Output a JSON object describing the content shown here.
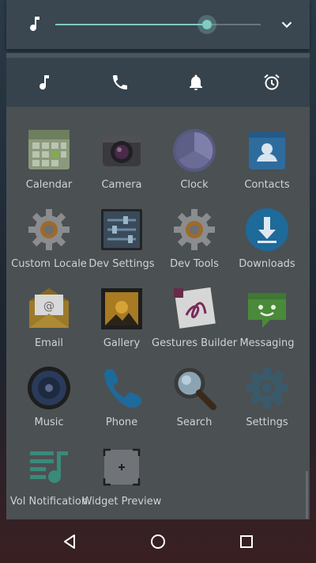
{
  "volume": {
    "level": 0.74,
    "accent": "#80cbc4"
  },
  "stream_icons": [
    "music-note-icon",
    "phone-icon",
    "bell-icon",
    "alarm-clock-icon"
  ],
  "apps": [
    {
      "label": "Calendar",
      "icon": "calendar-icon"
    },
    {
      "label": "Camera",
      "icon": "camera-icon"
    },
    {
      "label": "Clock",
      "icon": "clock-icon"
    },
    {
      "label": "Contacts",
      "icon": "contacts-icon"
    },
    {
      "label": "Custom Locale",
      "icon": "gear-icon"
    },
    {
      "label": "Dev Settings",
      "icon": "sliders-icon"
    },
    {
      "label": "Dev Tools",
      "icon": "gear-icon"
    },
    {
      "label": "Downloads",
      "icon": "download-icon"
    },
    {
      "label": "Email",
      "icon": "email-icon"
    },
    {
      "label": "Gallery",
      "icon": "gallery-icon"
    },
    {
      "label": "Gestures Builder",
      "icon": "gestures-icon"
    },
    {
      "label": "Messaging",
      "icon": "messaging-icon"
    },
    {
      "label": "Music",
      "icon": "speaker-icon"
    },
    {
      "label": "Phone",
      "icon": "phone-icon"
    },
    {
      "label": "Search",
      "icon": "magnifier-icon"
    },
    {
      "label": "Settings",
      "icon": "settings-icon"
    },
    {
      "label": "Vol Notification",
      "icon": "playlist-icon"
    },
    {
      "label": "Widget Preview",
      "icon": "widget-icon"
    }
  ],
  "nav": [
    "back-icon",
    "home-icon",
    "recents-icon"
  ]
}
